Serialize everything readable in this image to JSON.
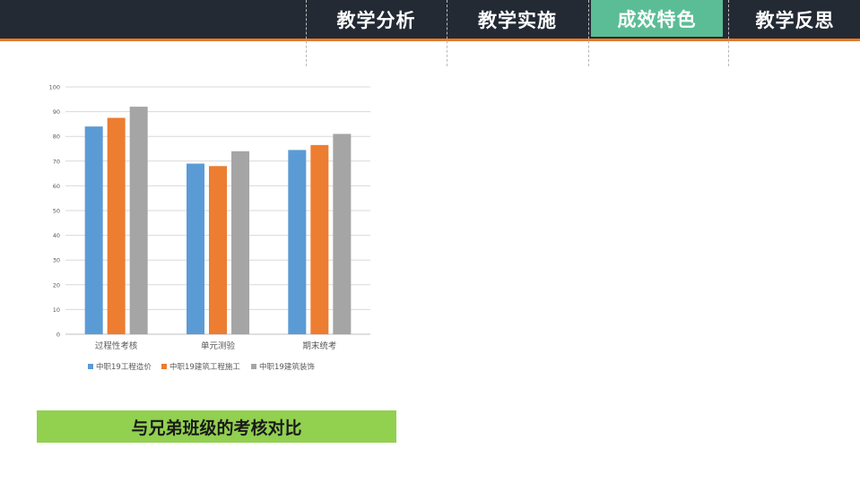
{
  "nav": {
    "tabs": [
      {
        "label": "教学分析",
        "active": false
      },
      {
        "label": "教学实施",
        "active": false
      },
      {
        "label": "成效特色",
        "active": true
      },
      {
        "label": "教学反思",
        "active": false
      }
    ]
  },
  "colors": {
    "topbar": "#232a34",
    "accent_line": "#e57a2a",
    "active_tab": "#5bbd96",
    "caption_bg": "#92d050"
  },
  "caption": "与兄弟班级的考核对比",
  "chart_data": {
    "type": "bar",
    "categories": [
      "过程性考核",
      "单元测验",
      "期末统考"
    ],
    "series": [
      {
        "name": "中职19工程造价",
        "color": "#5b9bd5",
        "values": [
          84,
          69,
          74.5
        ]
      },
      {
        "name": "中职19建筑工程施工",
        "color": "#ed7d31",
        "values": [
          87.5,
          68,
          76.5
        ]
      },
      {
        "name": "中职19建筑装饰",
        "color": "#a5a5a5",
        "values": [
          92,
          74,
          81
        ]
      }
    ],
    "ylim": [
      0,
      100
    ],
    "yticks": [
      0,
      10,
      20,
      30,
      40,
      50,
      60,
      70,
      80,
      90,
      100
    ],
    "grid": true,
    "legend": "bottom"
  }
}
